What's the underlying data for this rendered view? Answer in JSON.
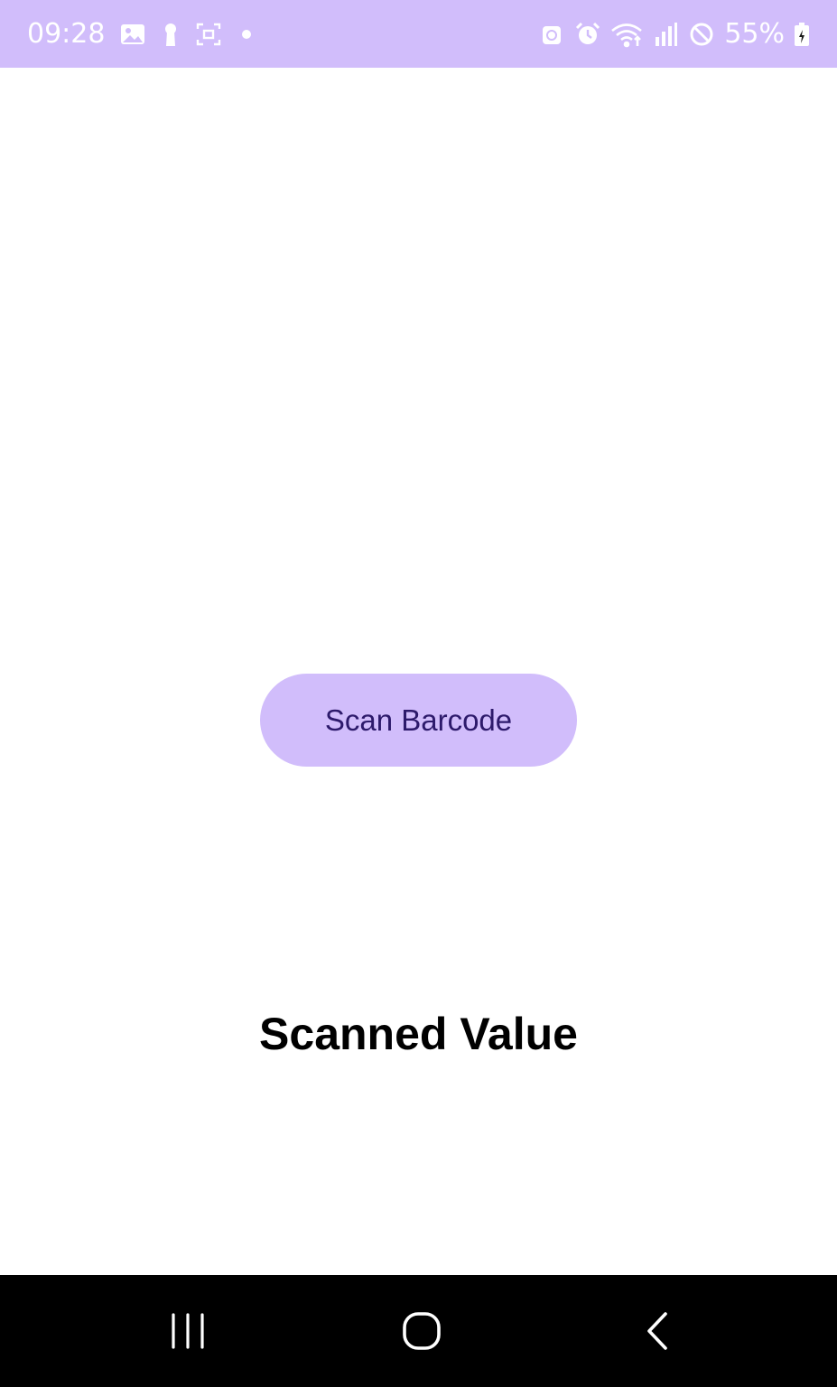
{
  "status_bar": {
    "time": "09:28",
    "battery_percent": "55%",
    "background_color": "#d1bdfb",
    "left_icons": [
      "gallery-icon",
      "keyhole-icon",
      "screenshot-icon",
      "notification-dot-icon"
    ],
    "right_icons": [
      "android-icon",
      "alarm-icon",
      "wifi-icon",
      "signal-icon",
      "do-not-disturb-icon",
      "battery-charging-icon"
    ]
  },
  "main": {
    "scan_button_label": "Scan Barcode",
    "scanned_value_text": "Scanned Value",
    "button_color": "#d1bdfb",
    "button_text_color": "#2d1a6b"
  },
  "nav_bar": {
    "background_color": "#000000",
    "buttons": [
      "recents-icon",
      "home-icon",
      "back-icon"
    ]
  }
}
